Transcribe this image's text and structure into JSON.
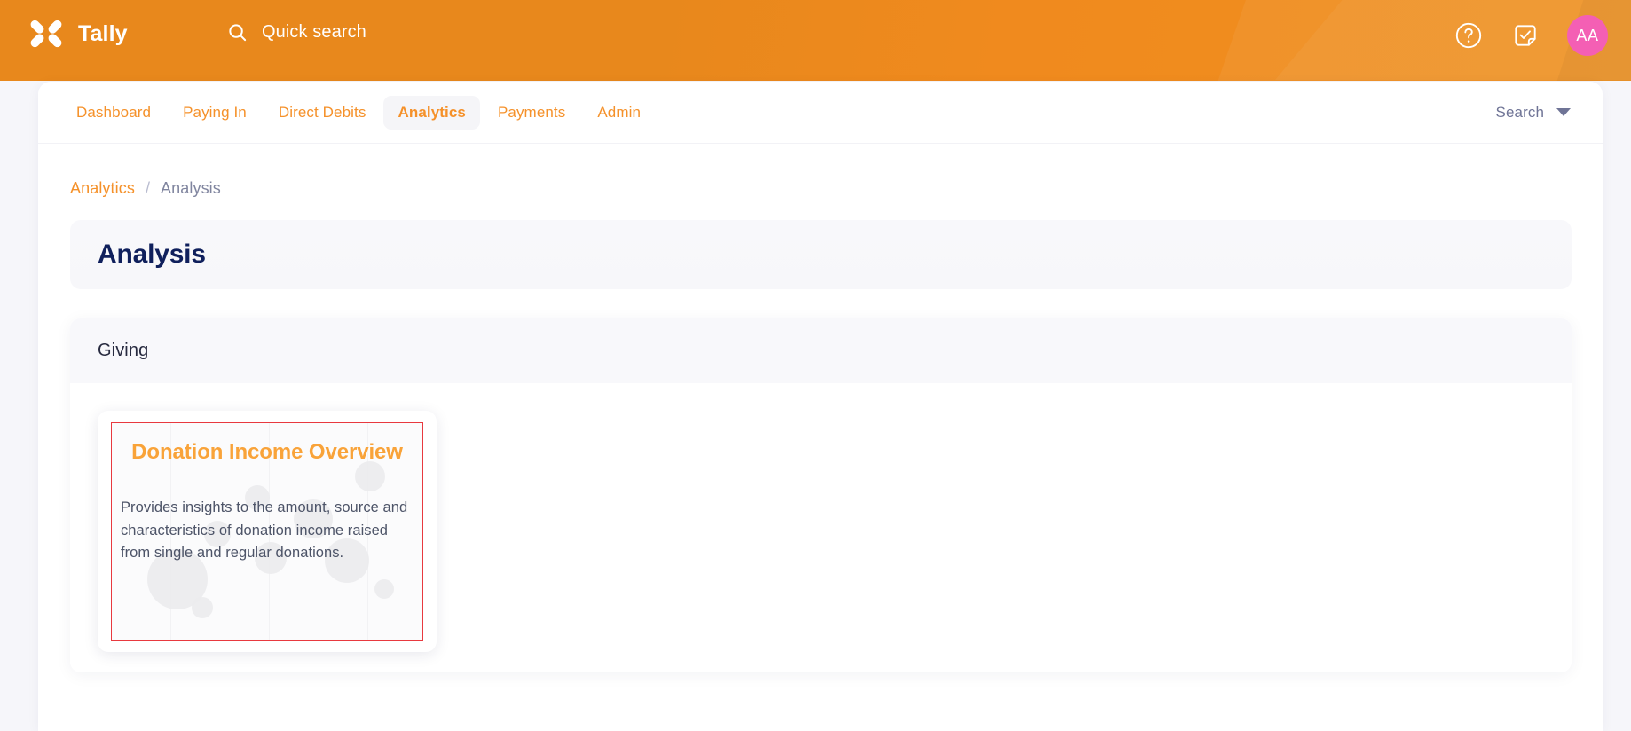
{
  "app": {
    "brand_name": "Tally",
    "logo_icon": "tally-pinwheel-logo"
  },
  "topbar": {
    "search": {
      "icon": "search-icon",
      "placeholder": "Quick search",
      "value": ""
    },
    "actions": [
      {
        "name": "help",
        "icon": "question-circle-icon",
        "label": ""
      },
      {
        "name": "tasks",
        "icon": "note-check-icon",
        "label": ""
      }
    ],
    "avatar": {
      "initials": "AA",
      "color": "#f45fb4"
    },
    "accent_color": "#e8881c"
  },
  "nav": {
    "items": [
      {
        "label": "Dashboard",
        "active": false
      },
      {
        "label": "Paying In",
        "active": false
      },
      {
        "label": "Direct Debits",
        "active": false
      },
      {
        "label": "Analytics",
        "active": true
      },
      {
        "label": "Payments",
        "active": false
      },
      {
        "label": "Admin",
        "active": false
      }
    ],
    "right": {
      "label": "Search",
      "icon": "chevron-down-icon"
    },
    "link_color": "#f5912a",
    "active_bg": "#f5f5f8"
  },
  "breadcrumb": {
    "parent": "Analytics",
    "separator": "/",
    "current": "Analysis"
  },
  "page": {
    "title": "Analysis",
    "title_color": "#10205c"
  },
  "sections": [
    {
      "heading": "Giving",
      "cards": [
        {
          "title": "Donation Income Overview",
          "description": "Provides insights to the amount, source and characteristics of donation income raised from single and regular donations.",
          "title_color": "#f9a339",
          "highlight_border_color": "#e8393f",
          "selected": true
        }
      ]
    }
  ]
}
